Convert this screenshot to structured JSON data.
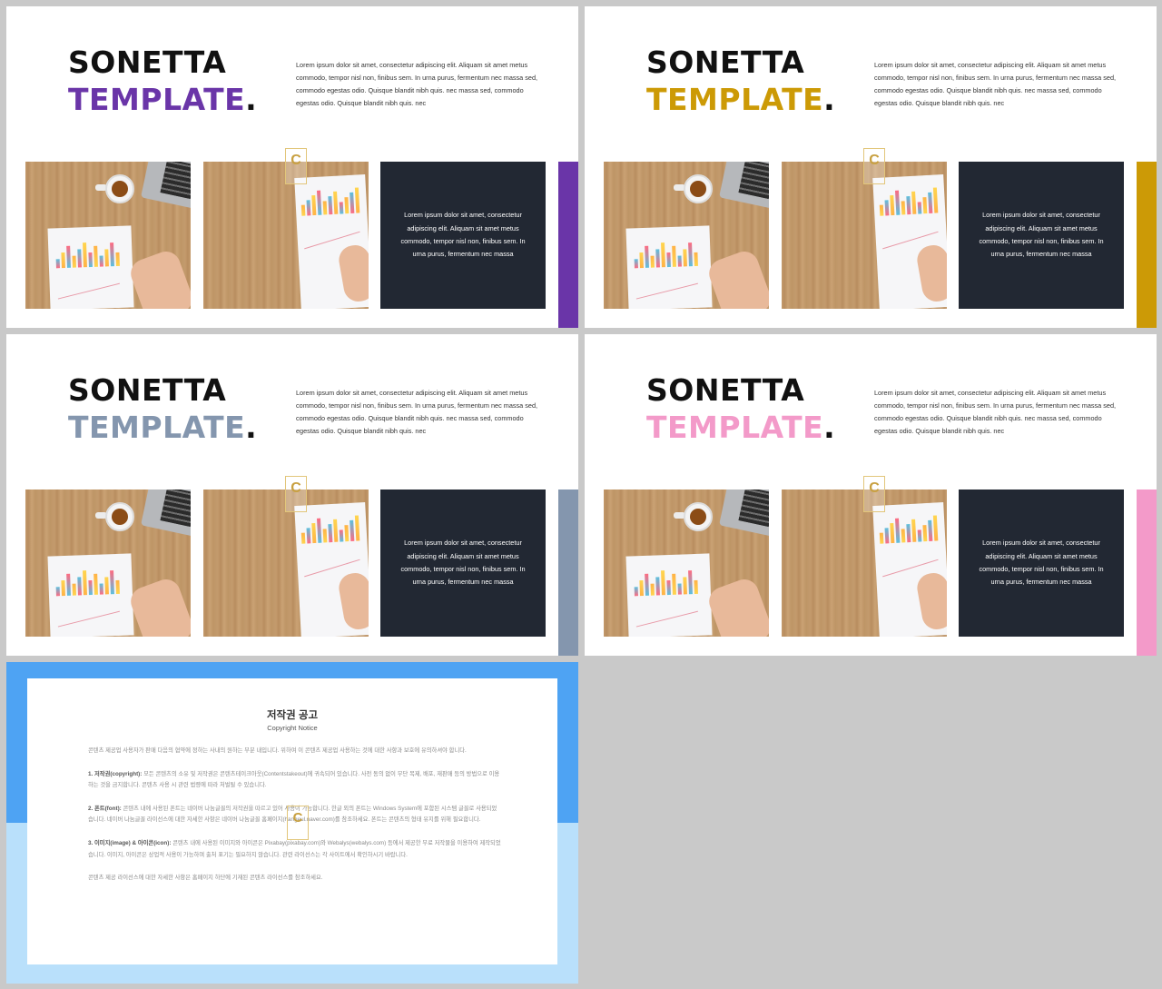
{
  "colors": {
    "dark_box": "#222833",
    "copyright_top": "#4ea3f3",
    "copyright_bottom": "#b9e0fb"
  },
  "slides": [
    {
      "title_line1": "SONETTA",
      "title_line2": "TEMPLATE",
      "title_dot": ".",
      "accent": "#6a35a8",
      "intro": "Lorem ipsum dolor sit amet, consectetur adipiscing elit. Aliquam sit amet metus commodo, tempor nisl non, finibus sem. In urna purus, fermentum nec massa sed, commodo egestas odio. Quisque blandit nibh quis. nec massa sed, commodo egestas odio. Quisque blandit nibh quis. nec",
      "box_text": "Lorem ipsum dolor sit amet, consectetur adipiscing elit. Aliquam sit amet metus commodo, tempor nisl non, finibus sem. In urna purus, fermentum nec massa"
    },
    {
      "title_line1": "SONETTA",
      "title_line2": "TEMPLATE",
      "title_dot": ".",
      "accent": "#cc9a06",
      "intro": "Lorem ipsum dolor sit amet, consectetur adipiscing elit. Aliquam sit amet metus commodo, tempor nisl non, finibus sem. In urna purus, fermentum nec massa sed, commodo egestas odio. Quisque blandit nibh quis. nec massa sed, commodo egestas odio. Quisque blandit nibh quis. nec",
      "box_text": "Lorem ipsum dolor sit amet, consectetur adipiscing elit. Aliquam sit amet metus commodo, tempor nisl non, finibus sem. In urna purus, fermentum nec massa"
    },
    {
      "title_line1": "SONETTA",
      "title_line2": "TEMPLATE",
      "title_dot": ".",
      "accent": "#8496ae",
      "intro": "Lorem ipsum dolor sit amet, consectetur adipiscing elit. Aliquam sit amet metus commodo, tempor nisl non, finibus sem. In urna purus, fermentum nec massa sed, commodo egestas odio. Quisque blandit nibh quis. nec massa sed, commodo egestas odio. Quisque blandit nibh quis. nec",
      "box_text": "Lorem ipsum dolor sit amet, consectetur adipiscing elit. Aliquam sit amet metus commodo, tempor nisl non, finibus sem. In urna purus, fermentum nec massa"
    },
    {
      "title_line1": "SONETTA",
      "title_line2": "TEMPLATE",
      "title_dot": ".",
      "accent": "#f39ac9",
      "intro": "Lorem ipsum dolor sit amet, consectetur adipiscing elit. Aliquam sit amet metus commodo, tempor nisl non, finibus sem. In urna purus, fermentum nec massa sed, commodo egestas odio. Quisque blandit nibh quis. nec massa sed, commodo egestas odio. Quisque blandit nibh quis. nec",
      "box_text": "Lorem ipsum dolor sit amet, consectetur adipiscing elit. Aliquam sit amet metus commodo, tempor nisl non, finibus sem. In urna purus, fermentum nec massa"
    }
  ],
  "watermark_letter": "C",
  "copyright": {
    "title": "저작권 공고",
    "subtitle": "Copyright Notice",
    "intro": "콘텐츠 제공업 사용자가 판매 다음의 협약에 정하는 사내의 원하는 부분 내입니다. 위하여 이 콘텐츠 제공업 사용하는 것에 대한 사항과 보호에 유의하셔야 합니다.",
    "items": [
      {
        "heading": "1. 저작권(copyright):",
        "text": "모든 콘텐츠의 소유 및 저작권은 콘텐츠테이크아웃(Contentstakeout)에 귀속되어 있습니다. 사전 동의 없이 무단 복제, 배포, 재판매 등의 방법으로 이용하는 것을 금지합니다. 콘텐츠 사용 시 관련 법령에 따라 처벌될 수 있습니다."
      },
      {
        "heading": "2. 폰트(font):",
        "text": "콘텐츠 내에 사용된 폰트는 네이버 나눔글꼴의 저작권을 따르고 있어 사용이 가능합니다. 한글 외의 폰트는 Windows System에 포함된 시스템 글꼴로 사용되었습니다. 네이버 나눔글꼴 라이선스에 대한 자세한 사항은 네이버 나눔글꼴 홈페이지(hangeul.naver.com)를 참조하세요. 폰트는 콘텐츠의 형태 유지를 위해 필요합니다."
      },
      {
        "heading": "3. 이미지(image) & 아이콘(icon):",
        "text": "콘텐츠 내에 사용된 이미지와 아이콘은 Pixabay(pixabay.com)와 Webalys(webalys.com) 등에서 제공한 무료 저작물을 이용하여 제작되었습니다. 이미지, 아이콘은 상업적 사용이 가능하며 출처 표기는 필요하지 않습니다. 관련 라이선스는 각 사이트에서 확인하시기 바랍니다."
      }
    ],
    "footer": "콘텐츠 제공 라이선스에 대한 자세한 사항은 홈페이지 하단에 기재된 콘텐츠 라이선스를 참조하세요."
  }
}
